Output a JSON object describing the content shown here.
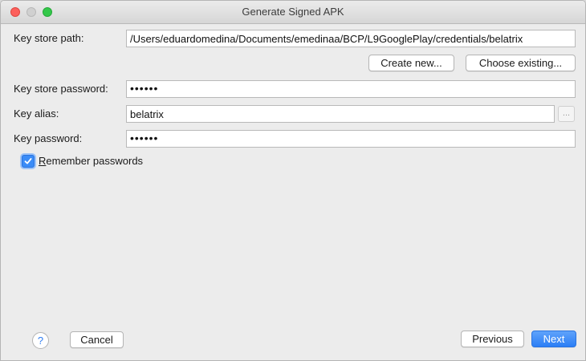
{
  "window": {
    "title": "Generate Signed APK"
  },
  "form": {
    "key_store_path_label": "Key store path:",
    "key_store_path_value": "/Users/eduardomedina/Documents/emedinaa/BCP/L9GooglePlay/credentials/belatrix",
    "create_new_label": "Create new...",
    "choose_existing_label": "Choose existing...",
    "key_store_password_label": "Key store password:",
    "key_store_password_value": "••••••",
    "key_alias_label": "Key alias:",
    "key_alias_value": "belatrix",
    "alias_browse_label": "...",
    "key_password_label": "Key password:",
    "key_password_value": "••••••",
    "remember_mnemonic": "R",
    "remember_rest": "emember passwords",
    "remember_checked": true
  },
  "footer": {
    "help_label": "?",
    "cancel_label": "Cancel",
    "previous_label": "Previous",
    "next_label": "Next"
  },
  "colors": {
    "accent": "#2b7ef5",
    "close": "#fc605c",
    "maximize": "#34c84a"
  },
  "icons": {
    "checkbox": "checkmark-icon",
    "help": "question-icon"
  }
}
